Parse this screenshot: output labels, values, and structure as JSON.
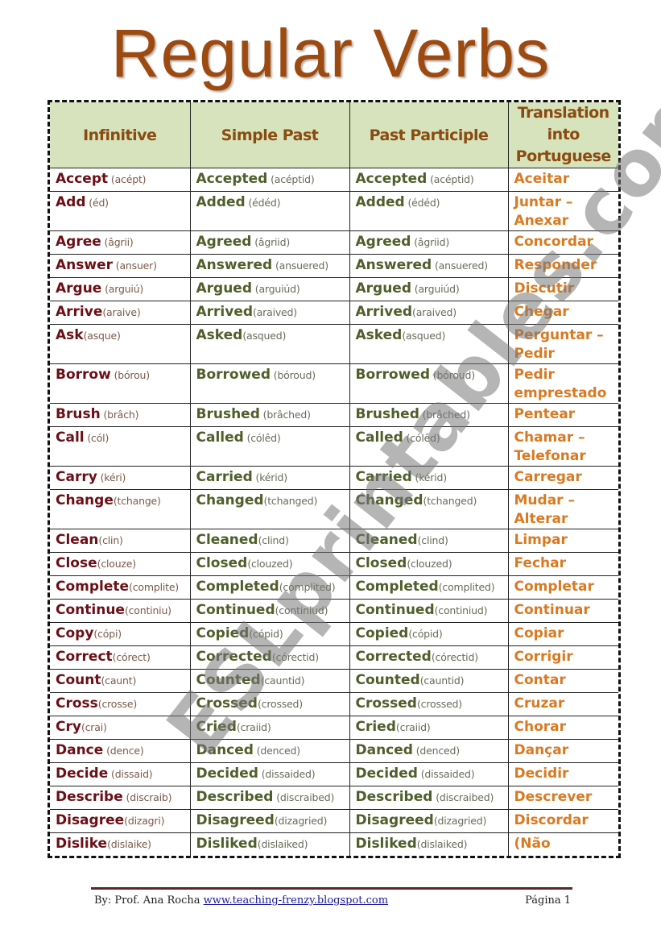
{
  "title": "Regular Verbs",
  "headers": {
    "infinitive": "Infinitive",
    "simple_past": "Simple Past",
    "past_participle": "Past Participle",
    "translation": "Translation into Portuguese"
  },
  "rows": [
    {
      "inf": "Accept",
      "inf_p": " (acépt)",
      "sp": "Accepted",
      "sp_p": " (acéptid)",
      "pp": "Accepted",
      "pp_p": " (acéptid)",
      "tr": "Aceitar",
      "tall": false
    },
    {
      "inf": "Add",
      "inf_p": "  (éd)",
      "sp": "Added",
      "sp_p": "  (édéd)",
      "pp": "Added",
      "pp_p": "  (édéd)",
      "tr": "Juntar – Anexar",
      "tall": true
    },
    {
      "inf": "Agree",
      "inf_p": " (âgrii)",
      "sp": "Agreed",
      "sp_p": " (âgriid)",
      "pp": "Agreed",
      "pp_p": " (âgriid)",
      "tr": "Concordar",
      "tall": false
    },
    {
      "inf": "Answer",
      "inf_p": " (ansuer)",
      "sp": "Answered",
      "sp_p": " (ansuered)",
      "pp": "Answered",
      "pp_p": " (ansuered)",
      "tr": "Responder",
      "tall": false
    },
    {
      "inf": "Argue",
      "inf_p": " (arguiú)",
      "sp": "Argued",
      "sp_p": " (arguiúd)",
      "pp": "Argued",
      "pp_p": " (arguiúd)",
      "tr": "Discutir",
      "tall": false
    },
    {
      "inf": "Arrive",
      "inf_p": "(araive)",
      "sp": "Arrived",
      "sp_p": "(araived)",
      "pp": "Arrived",
      "pp_p": "(araived)",
      "tr": "Chegar",
      "tall": false
    },
    {
      "inf": "Ask",
      "inf_p": "(asque)",
      "sp": "Asked",
      "sp_p": "(asqued)",
      "pp": "Asked",
      "pp_p": "(asqued)",
      "tr": "Perguntar – Pedir",
      "tall": true
    },
    {
      "inf": "Borrow",
      "inf_p": " (bórou)",
      "sp": "Borrowed",
      "sp_p": " (bóroud)",
      "pp": "Borrowed",
      "pp_p": " (bóroud)",
      "tr": "Pedir emprestado",
      "tall": true
    },
    {
      "inf": "Brush",
      "inf_p": " (brâch)",
      "sp": "Brushed",
      "sp_p": " (brâched)",
      "pp": "Brushed",
      "pp_p": " (brâched)",
      "tr": "Pentear",
      "tall": false
    },
    {
      "inf": "Call",
      "inf_p": " (cól)",
      "sp": "Called",
      "sp_p": " (cólêd)",
      "pp": "Called",
      "pp_p": " (cólêd)",
      "tr": "Chamar – Telefonar",
      "tall": true
    },
    {
      "inf": "Carry",
      "inf_p": " (kéri)",
      "sp": "Carried",
      "sp_p": " (kérid)",
      "pp": "Carried",
      "pp_p": " (kérid)",
      "tr": "Carregar",
      "tall": false
    },
    {
      "inf": "Change",
      "inf_p": "(tchange)",
      "sp": "Changed",
      "sp_p": "(tchanged)",
      "pp": "Changed",
      "pp_p": "(tchanged)",
      "tr": "Mudar – Alterar",
      "tall": true
    },
    {
      "inf": "Clean",
      "inf_p": "(clin)",
      "sp": "Cleaned",
      "sp_p": "(clind)",
      "pp": "Cleaned",
      "pp_p": "(clind)",
      "tr": "Limpar",
      "tall": false
    },
    {
      "inf": "Close",
      "inf_p": "(clouze)",
      "sp": "Closed",
      "sp_p": "(clouzed)",
      "pp": "Closed",
      "pp_p": "(clouzed)",
      "tr": "Fechar",
      "tall": false
    },
    {
      "inf": "Complete",
      "inf_p": "(complite)",
      "sp": "Completed",
      "sp_p": "(complited)",
      "pp": "Completed",
      "pp_p": "(complited)",
      "tr": "Completar",
      "tall": false
    },
    {
      "inf": "Continue",
      "inf_p": "(continiu)",
      "sp": "Continued",
      "sp_p": "(continiud)",
      "pp": "Continued",
      "pp_p": "(continiud)",
      "tr": "Continuar",
      "tall": false
    },
    {
      "inf": "Copy",
      "inf_p": "(cópi)",
      "sp": "Copied",
      "sp_p": "(cópid)",
      "pp": "Copied",
      "pp_p": "(cópid)",
      "tr": "Copiar",
      "tall": false
    },
    {
      "inf": "Correct",
      "inf_p": "(córect)",
      "sp": "Corrected",
      "sp_p": "(córectid)",
      "pp": "Corrected",
      "pp_p": "(córectid)",
      "tr": "Corrigir",
      "tall": false
    },
    {
      "inf": "Count",
      "inf_p": "(caunt)",
      "sp": "Counted",
      "sp_p": "(cauntid)",
      "pp": "Counted",
      "pp_p": "(cauntid)",
      "tr": "Contar",
      "tall": false
    },
    {
      "inf": "Cross",
      "inf_p": "(crosse)",
      "sp": "Crossed",
      "sp_p": "(crossed)",
      "pp": "Crossed",
      "pp_p": "(crossed)",
      "tr": "Cruzar",
      "tall": false
    },
    {
      "inf": "Cry",
      "inf_p": "(crai)",
      "sp": "Cried",
      "sp_p": "(craiid)",
      "pp": "Cried",
      "pp_p": "(craiid)",
      "tr": "Chorar",
      "tall": false
    },
    {
      "inf": "Dance",
      "inf_p": " (dence)",
      "sp": "Danced",
      "sp_p": " (denced)",
      "pp": "Danced",
      "pp_p": " (denced)",
      "tr": "Dançar",
      "tall": false
    },
    {
      "inf": "Decide",
      "inf_p": " (dissaid)",
      "sp": "Decided",
      "sp_p": " (dissaided)",
      "pp": "Decided",
      "pp_p": " (dissaided)",
      "tr": "Decidir",
      "tall": false
    },
    {
      "inf": "Describe",
      "inf_p": " (discraib)",
      "sp": "Described",
      "sp_p": " (discraibed)",
      "pp": "Described",
      "pp_p": " (discraibed)",
      "tr": "Descrever",
      "tall": false
    },
    {
      "inf": "Disagree",
      "inf_p": "(dizagri)",
      "sp": "Disagreed",
      "sp_p": "(dizagried)",
      "pp": "Disagreed",
      "pp_p": "(dizagried)",
      "tr": "Discordar",
      "tall": false
    },
    {
      "inf": "Dislike",
      "inf_p": "(dislaike)",
      "sp": "Disliked",
      "sp_p": "(dislaiked)",
      "pp": "Disliked",
      "pp_p": "(dislaiked)",
      "tr": " (Não",
      "tall": false
    }
  ],
  "watermark": "ESLprintables.com",
  "footer": {
    "author": "By: Prof.  Ana Rocha ",
    "link": "www.teaching-frenzy.blogspot.com",
    "page": "Página 1"
  },
  "colors": {
    "title": "#9c4a10",
    "header_bg": "#d6e3bc",
    "header_text": "#8b4a10",
    "infinitive": "#6b0f16",
    "past_forms": "#4f5e2a",
    "translation": "#d97a22"
  }
}
